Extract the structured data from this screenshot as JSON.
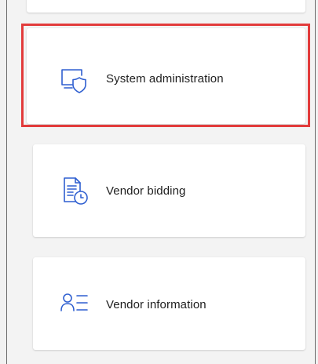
{
  "tiles": [
    {
      "label": "System administration",
      "icon": "monitor-shield-icon",
      "highlighted": true
    },
    {
      "label": "Vendor bidding",
      "icon": "document-clock-icon"
    },
    {
      "label": "Vendor information",
      "icon": "person-list-icon"
    }
  ],
  "colors": {
    "accent": "#2f5fd0",
    "highlight": "#e23b3b",
    "tile_background": "#ffffff",
    "page_background": "#f3f3f3"
  }
}
